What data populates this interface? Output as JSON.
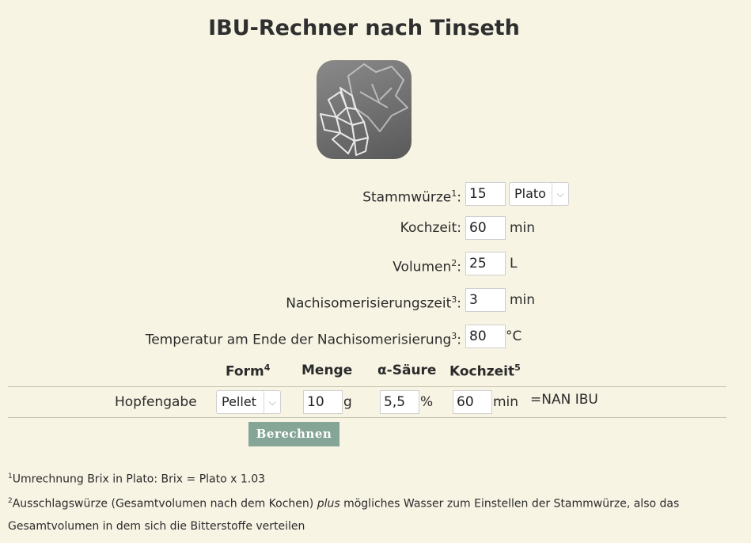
{
  "title": "IBU-Rechner nach Tinseth",
  "logo": {
    "icon": "hop-cone-icon"
  },
  "fields": {
    "stammwuerze": {
      "label": "Stammwürze",
      "sup": "1",
      "value": "15",
      "unit_select": "Plato"
    },
    "kochzeit": {
      "label": "Kochzeit",
      "value": "60",
      "unit": "min"
    },
    "volumen": {
      "label": "Volumen",
      "sup": "2",
      "value": "25",
      "unit": "L"
    },
    "nachiso_zeit": {
      "label": "Nachisomerisierungszeit",
      "sup": "3",
      "value": "3",
      "unit": "min"
    },
    "temperatur": {
      "label": "Temperatur am Ende der Nachisomerisierung",
      "sup": "3",
      "value": "80",
      "unit": "°C"
    }
  },
  "hop_table": {
    "headers": {
      "form": "Form",
      "form_sup": "4",
      "menge": "Menge",
      "alpha": "α-Säure",
      "kochzeit": "Kochzeit",
      "kochzeit_sup": "5"
    },
    "row": {
      "label": "Hopfengabe",
      "form": "Pellet",
      "menge": "10",
      "menge_unit": "g",
      "alpha": "5,5",
      "alpha_unit": "%",
      "kochzeit": "60",
      "kochzeit_unit": "min",
      "result": "=NAN IBU"
    }
  },
  "calculate_button": "Berechnen",
  "footnotes": {
    "f1_sup": "1",
    "f1": "Umrechnung Brix in Plato: Brix = Plato x 1.03",
    "f2_sup": "2",
    "f2_a": "Ausschlagswürze (Gesamtvolumen nach dem Kochen) ",
    "f2_em": "plus",
    "f2_b": " mögliches Wasser zum Einstellen der Stammwürze, also das",
    "f2_c": "Gesamtvolumen in dem sich die Bitterstoffe verteilen"
  }
}
